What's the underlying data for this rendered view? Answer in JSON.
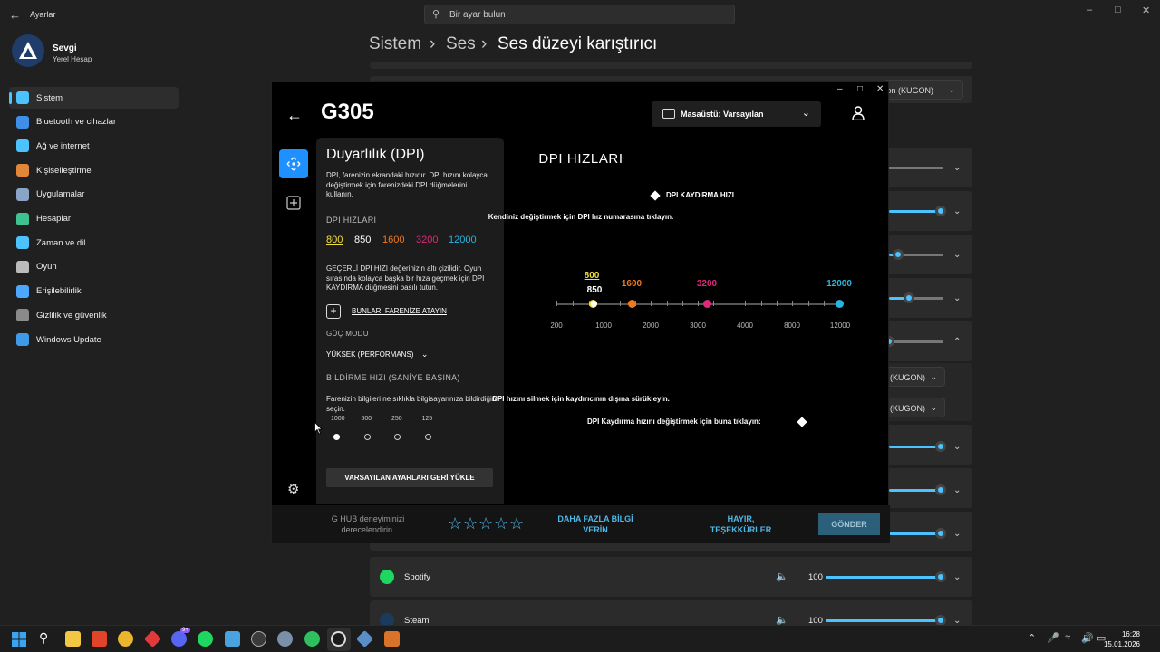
{
  "settings": {
    "app_title": "Ayarlar",
    "search_placeholder": "Bir ayar bulun",
    "user": {
      "name": "Sevgi",
      "type": "Yerel Hesap"
    },
    "sidebar": [
      {
        "label": "Sistem",
        "icon": "monitor-icon",
        "color": "#4cc2ff"
      },
      {
        "label": "Bluetooth ve cihazlar",
        "icon": "bluetooth-icon",
        "color": "#3f8fe8"
      },
      {
        "label": "Ağ ve internet",
        "icon": "wifi-icon",
        "color": "#4cc2ff"
      },
      {
        "label": "Kişiselleştirme",
        "icon": "brush-icon",
        "color": "#e0873a"
      },
      {
        "label": "Uygulamalar",
        "icon": "apps-icon",
        "color": "#8aa4c8"
      },
      {
        "label": "Hesaplar",
        "icon": "person-icon",
        "color": "#3ec28f"
      },
      {
        "label": "Zaman ve dil",
        "icon": "globe-icon",
        "color": "#4cc2ff"
      },
      {
        "label": "Oyun",
        "icon": "gamepad-icon",
        "color": "#bbbbbb"
      },
      {
        "label": "Erişilebilirlik",
        "icon": "accessibility-icon",
        "color": "#4ca8ff"
      },
      {
        "label": "Gizlilik ve güvenlik",
        "icon": "shield-icon",
        "color": "#8a8a8a"
      },
      {
        "label": "Windows Update",
        "icon": "update-icon",
        "color": "#3f9be8"
      }
    ],
    "breadcrumb": [
      "Sistem",
      "Ses",
      "Ses düzeyi karıştırıcı"
    ],
    "device_dropdown_1": "fon (KUGON)",
    "device_dropdown_2": "(KUGON)",
    "device_dropdown_3": "(KUGON)",
    "apps": [
      {
        "name": "Spotify",
        "volume": "100",
        "level": 100
      },
      {
        "name": "Steam",
        "volume": "100",
        "level": 100
      }
    ]
  },
  "ghub": {
    "device": "G305",
    "profile": "Masaüstü: Varsayılan",
    "panel": {
      "heading": "Duyarlılık (DPI)",
      "description": "DPI, farenizin ekrandaki hızıdır. DPI hızını kolayca değiştirmek için farenizdeki DPI düğmelerini kullanın.",
      "dpi_speeds_label": "DPI HIZLARI",
      "dpi_values": [
        {
          "value": "800",
          "color": "#f4e03a"
        },
        {
          "value": "850",
          "color": "#ffffff"
        },
        {
          "value": "1600",
          "color": "#f07a20"
        },
        {
          "value": "3200",
          "color": "#e0287a"
        },
        {
          "value": "12000",
          "color": "#28b4e0"
        }
      ],
      "current_info": "GEÇERLİ DPI HIZI değerinizin altı çizilidir. Oyun sırasında kolayca başka bir hıza geçmek için DPI KAYDIRMA düğmesini basılı tutun.",
      "assign_label": "BUNLARI FARENİZE ATAYIN",
      "power_mode_label": "GÜÇ MODU",
      "power_mode_value": "YÜKSEK (PERFORMANS)",
      "report_rate_label": "BİLDİRME HIZI (SANİYE BAŞINA)",
      "report_rate_desc": "Farenizin bilgileri ne sıklıkla bilgisayarınıza bildirdiğini seçin.",
      "report_rates": [
        "1000",
        "500",
        "250",
        "125"
      ],
      "report_rate_selected": "1000",
      "reset_label": "VARSAYILAN AYARLARI GERİ YÜKLE"
    },
    "right": {
      "title": "DPI HIZLARI",
      "shift_label": "DPI KAYDIRMA HIZI",
      "hint": "Kendiniz değiştirmek için DPI hız numarasına tıklayın.",
      "axis_labels": [
        "200",
        "1000",
        "2000",
        "3000",
        "4000",
        "8000",
        "12000"
      ],
      "markers": [
        {
          "label": "800",
          "color": "#f4e03a"
        },
        {
          "label": "850",
          "color": "#ffffff"
        },
        {
          "label": "1600",
          "color": "#f07a20"
        },
        {
          "label": "3200",
          "color": "#e0287a"
        },
        {
          "label": "12000",
          "color": "#28b4e0"
        }
      ],
      "delete_hint": "DPI hızını silmek için kaydırıcının dışına sürükleyin.",
      "shift_hint": "DPI Kaydırma hızını değiştirmek için buna tıklayın:"
    },
    "feedback": {
      "prompt": "G HUB deneyiminizi derecelendirin.",
      "more_info": "DAHA FAZLA BİLGİ VERİN",
      "no_thanks": "HAYIR, TEŞEKKÜRLER",
      "send": "GÖNDER"
    }
  },
  "taskbar": {
    "time": "16:28",
    "date": "15.01.2026",
    "badge": "9+"
  }
}
